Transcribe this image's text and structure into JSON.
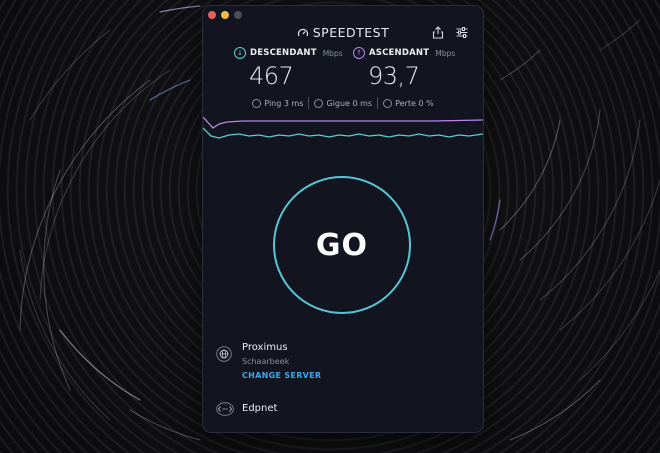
{
  "app": {
    "title": "SPEEDTEST"
  },
  "window_controls": [
    "close",
    "minimize",
    "zoom"
  ],
  "download": {
    "label": "DESCENDANT",
    "unit": "Mbps",
    "value": "467",
    "icon": "download-arrow-icon",
    "color": "#5ad1c9"
  },
  "upload": {
    "label": "ASCENDANT",
    "unit": "Mbps",
    "value": "93,7",
    "icon": "upload-arrow-icon",
    "color": "#b887e8"
  },
  "stats": {
    "ping": "Ping 3 ms",
    "jitter": "Gigue 0 ms",
    "loss": "Perte 0 %"
  },
  "go_button": {
    "label": "GO",
    "ring_color": "#56c6d6"
  },
  "server": {
    "isp": "Proximus",
    "city": "Schaarbeek",
    "change_label": "CHANGE SERVER",
    "link_color": "#3fa9e6"
  },
  "provider": {
    "name": "Edpnet"
  },
  "toolbar": {
    "share_icon": "share-icon",
    "settings_icon": "settings-sliders-icon"
  }
}
